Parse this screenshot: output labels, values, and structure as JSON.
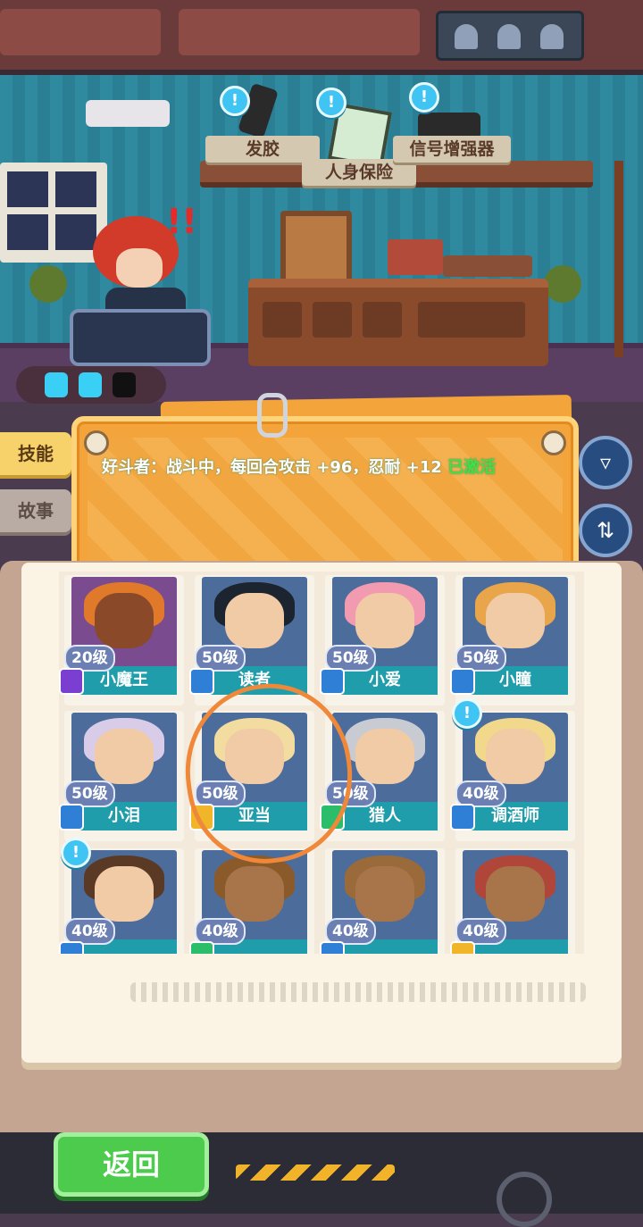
{
  "shelf": {
    "items": [
      "发胶",
      "人身保险",
      "信号增强器"
    ]
  },
  "tabs": {
    "skill": "技能",
    "story": "故事"
  },
  "skill": {
    "text": "好斗者：战斗中，每回合攻击 +96，忍耐 +12",
    "status": "已激活"
  },
  "characters": [
    {
      "name": "小魔王",
      "level": "20级",
      "rank": "purple"
    },
    {
      "name": "读者",
      "level": "50级",
      "rank": "blue"
    },
    {
      "name": "小爱",
      "level": "50级",
      "rank": "blue"
    },
    {
      "name": "小瞳",
      "level": "50级",
      "rank": "blue"
    },
    {
      "name": "小泪",
      "level": "50级",
      "rank": "blue"
    },
    {
      "name": "亚当",
      "level": "50级",
      "rank": "gold"
    },
    {
      "name": "猎人",
      "level": "50级",
      "rank": "green"
    },
    {
      "name": "调酒师",
      "level": "40级",
      "rank": "blue"
    },
    {
      "name": "",
      "level": "40级",
      "rank": "blue"
    },
    {
      "name": "",
      "level": "40级",
      "rank": "green"
    },
    {
      "name": "",
      "level": "40级",
      "rank": "blue"
    },
    {
      "name": "",
      "level": "40级",
      "rank": "gold"
    }
  ],
  "bottom": {
    "back_label": "返回"
  },
  "icons": {
    "filter": "filter-icon",
    "sort": "sort-icon",
    "energy": "energy-icon",
    "alert": "alert-bubble-icon"
  },
  "colors": {
    "active": "#44e043",
    "name_bar": "#1f9dab",
    "back_button": "#4ccb4c"
  }
}
